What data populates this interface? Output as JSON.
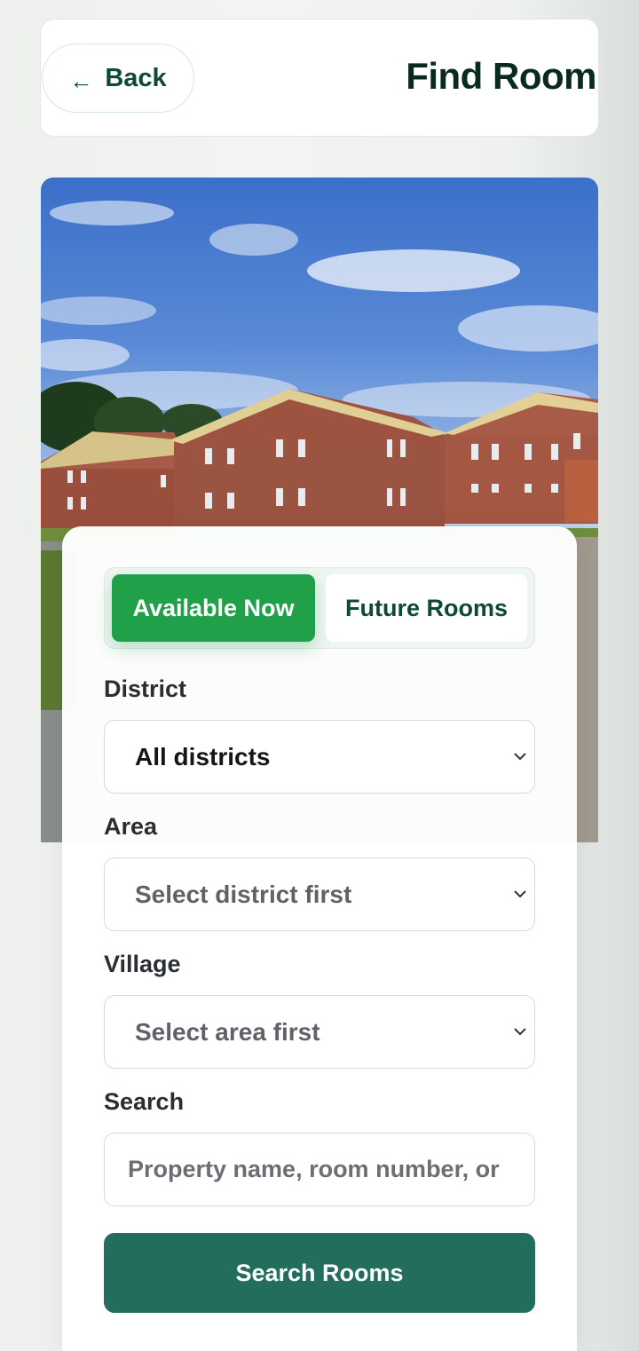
{
  "header": {
    "back_label": "Back",
    "back_arrow": "←",
    "title": "Find Room"
  },
  "hero": {
    "icon": "photo-of-brick-residence-buildings"
  },
  "tabs": [
    {
      "label": "Available Now",
      "active": true
    },
    {
      "label": "Future Rooms",
      "active": false
    }
  ],
  "form": {
    "district": {
      "label": "District",
      "value": "All districts"
    },
    "area": {
      "label": "Area",
      "value": "Select district first"
    },
    "village": {
      "label": "Village",
      "value": "Select area first"
    },
    "search": {
      "label": "Search",
      "placeholder": "Property name, room number, or"
    },
    "submit_label": "Search Rooms"
  },
  "colors": {
    "brand_dark": "#0d4a33",
    "active_tab": "#21a04a",
    "submit": "#236d5f"
  }
}
